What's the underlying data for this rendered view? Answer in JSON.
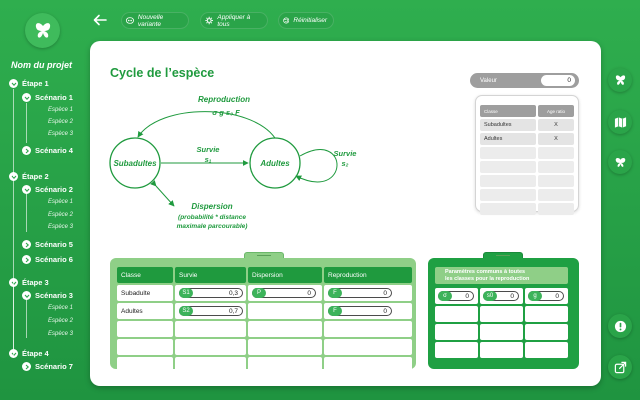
{
  "project_name": "Nom du projet",
  "tree": [
    {
      "type": "etape",
      "label": "Étape 1",
      "expanded": true
    },
    {
      "type": "scen",
      "label": "Scénario 1",
      "expanded": true
    },
    {
      "type": "esp",
      "label": "Espèce 1"
    },
    {
      "type": "esp",
      "label": "Espèce 2"
    },
    {
      "type": "esp",
      "label": "Espèce 3"
    },
    {
      "type": "scen",
      "label": "Scénario 4",
      "expanded": false
    },
    {
      "type": "etape",
      "label": "Étape 2",
      "expanded": true
    },
    {
      "type": "scen",
      "label": "Scénario 2",
      "expanded": true
    },
    {
      "type": "esp",
      "label": "Espèce 1"
    },
    {
      "type": "esp",
      "label": "Espèce 2"
    },
    {
      "type": "esp",
      "label": "Espèce 3"
    },
    {
      "type": "scen",
      "label": "Scénario 5",
      "expanded": false
    },
    {
      "type": "scen",
      "label": "Scénario 6",
      "expanded": false
    },
    {
      "type": "etape",
      "label": "Étape 3",
      "expanded": true
    },
    {
      "type": "scen",
      "label": "Scénario 3",
      "expanded": true
    },
    {
      "type": "esp",
      "label": "Espèce 1"
    },
    {
      "type": "esp",
      "label": "Espèce 2"
    },
    {
      "type": "esp",
      "label": "Espèce 3"
    },
    {
      "type": "etape",
      "label": "Étape 4",
      "expanded": true
    },
    {
      "type": "scen",
      "label": "Scénario 7",
      "expanded": false
    }
  ],
  "toolbar": {
    "new_variant": "Nouvelle variante",
    "apply_all": "Appliquer à tous",
    "reset": "Réinitialiser"
  },
  "page_title": "Cycle de l’espèce",
  "diagram": {
    "reproduction_label": "Reproduction",
    "reproduction_formula": "σ g s₀ F",
    "node_subadults": "Subadultes",
    "node_adults": "Adultes",
    "survie_1_label": "Survie",
    "survie_1_sym": "s₁",
    "survie_2_label": "Survie",
    "survie_2_sym": "s₂",
    "dispersion_label": "Dispersion",
    "dispersion_desc_1": "(probabilité * distance",
    "dispersion_desc_2": "maximale parcourable)"
  },
  "valeur": {
    "label": "Valeur",
    "value": "0"
  },
  "side_table": {
    "headers": [
      "Classe",
      "Age ratio"
    ],
    "rows": [
      [
        "Subadultes",
        "X"
      ],
      [
        "Adultes",
        "X"
      ]
    ],
    "empty_rows": 5
  },
  "main_table": {
    "headers": [
      "Classe",
      "Survie",
      "Dispersion",
      "Reproduction"
    ],
    "rows": [
      {
        "classe": "Subadulte",
        "survie": {
          "tag": "S1",
          "value": "0,3"
        },
        "dispersion": {
          "tag": "P",
          "value": "0"
        },
        "reproduction": {
          "tag": "F",
          "value": "0"
        }
      },
      {
        "classe": "Adultes",
        "survie": {
          "tag": "S2",
          "value": "0,7"
        },
        "dispersion": null,
        "reproduction": {
          "tag": "F",
          "value": "0"
        }
      }
    ],
    "empty_rows": 3
  },
  "common_params": {
    "title_line_1": "Paramètres communs à toutes",
    "title_line_2": "les classes pour la reproduction",
    "fields": [
      {
        "tag": "σ",
        "value": "0"
      },
      {
        "tag": "s0",
        "value": "0"
      },
      {
        "tag": "g",
        "value": "0"
      }
    ],
    "empty_rows": 3
  },
  "right_icons": [
    "butterfly-icon",
    "map-icon",
    "species-icon",
    "alert-icon",
    "export-icon"
  ],
  "colors": {
    "primary": "#1f9a3e",
    "light_green": "#8fcf87",
    "background": "#2fae4e"
  }
}
